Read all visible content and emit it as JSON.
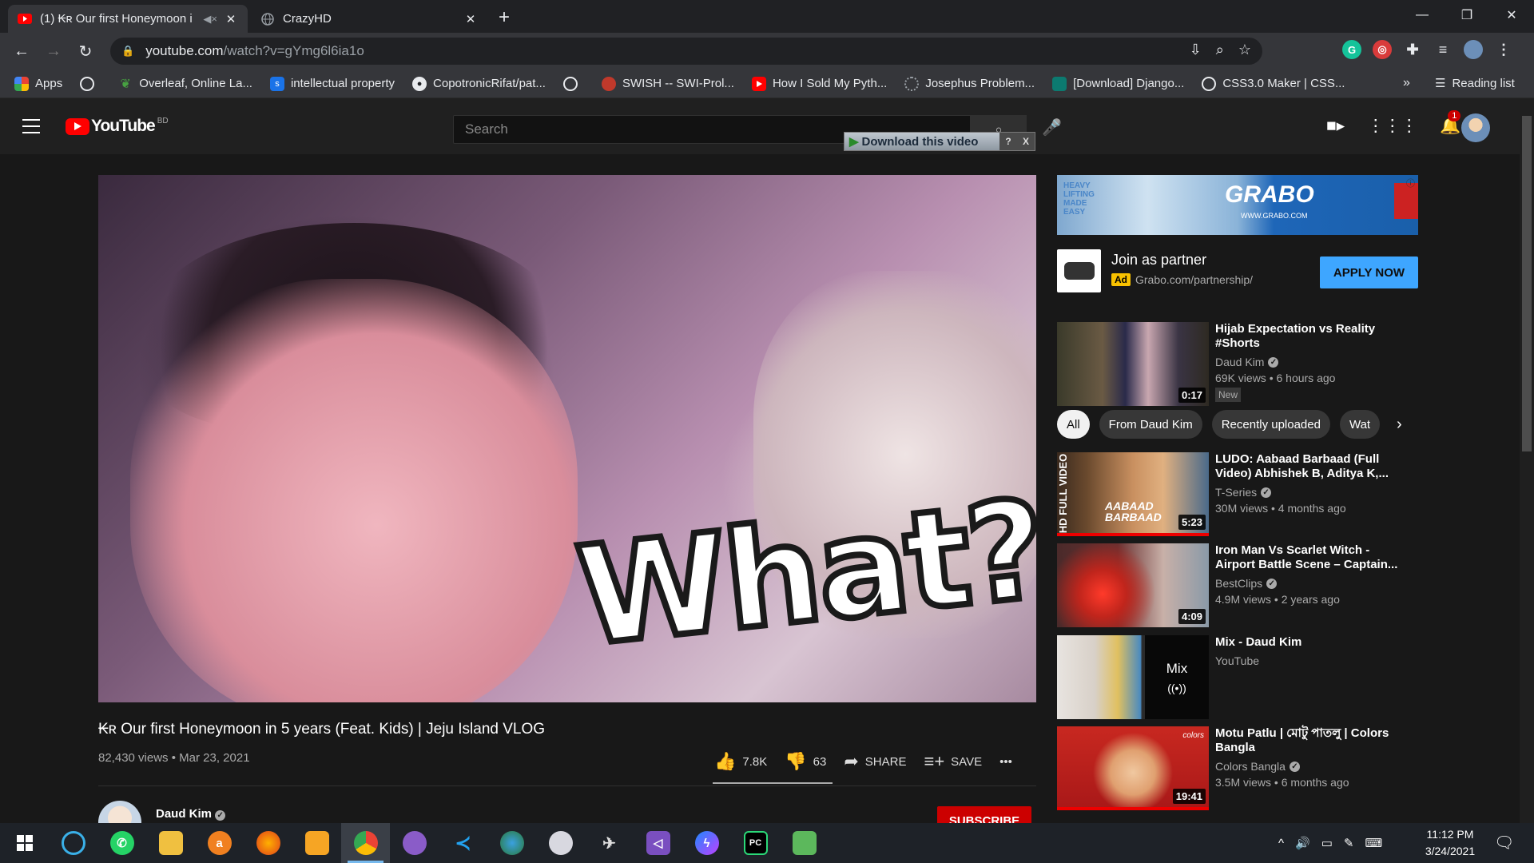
{
  "browser": {
    "tabs": [
      {
        "title": "(1) ₭ʀ Our first Honeymoon i",
        "audio": "◀×",
        "active": true
      },
      {
        "title": "CrazyHD",
        "active": false
      }
    ],
    "url_host": "youtube.com",
    "url_path": "/watch?v=gYmg6l6ia1o",
    "bookmarks": [
      {
        "label": "Apps",
        "icon": "apps-icon"
      },
      {
        "label": "",
        "icon": "globe-icon"
      },
      {
        "label": "Overleaf, Online La...",
        "icon": "overleaf-icon"
      },
      {
        "label": "intellectual property",
        "icon": "s-icon"
      },
      {
        "label": "CopotronicRifat/pat...",
        "icon": "github-icon"
      },
      {
        "label": "",
        "icon": "globe-icon"
      },
      {
        "label": "SWISH -- SWI-Prol...",
        "icon": "swish-icon"
      },
      {
        "label": "How I Sold My Pyth...",
        "icon": "youtube-icon"
      },
      {
        "label": "Josephus Problem...",
        "icon": "loading-icon"
      },
      {
        "label": "[Download] Django...",
        "icon": "django-icon"
      },
      {
        "label": "CSS3.0 Maker | CSS...",
        "icon": "globe-icon"
      }
    ],
    "bookmarks_more": "»",
    "reading_list": "Reading list"
  },
  "youtube": {
    "logo_text": "YouTube",
    "country": "BD",
    "search_placeholder": "Search",
    "download_bar": "Download this video",
    "download_help": "?",
    "download_close": "X",
    "notification_count": "1"
  },
  "video": {
    "overlay_text": "What?",
    "title": "₭ʀ Our first Honeymoon in 5 years (Feat. Kids) | Jeju Island VLOG",
    "views": "82,430 views",
    "date": "Mar 23, 2021",
    "likes": "7.8K",
    "dislikes": "63",
    "share_label": "SHARE",
    "save_label": "SAVE",
    "more_label": "•••",
    "channel": "Daud Kim",
    "subscribe_label": "SUBSCRIBE"
  },
  "ad": {
    "banner_brand": "GRABO",
    "banner_slogan": "HEAVY LIFTING MADE EASY",
    "banner_site": "WWW.GRABO.COM",
    "title": "Join as partner",
    "badge": "Ad",
    "url": "Grabo.com/partnership/",
    "cta": "APPLY NOW"
  },
  "chips": [
    "All",
    "From Daud Kim",
    "Recently uploaded",
    "Wat"
  ],
  "recommendations": [
    {
      "title": "Hijab Expectation vs Reality #Shorts",
      "channel": "Daud Kim",
      "verified": true,
      "meta": "69K views • 6 hours ago",
      "badge": "New",
      "duration": "0:17"
    },
    {
      "title": "LUDO: Aabaad Barbaad (Full Video) Abhishek B, Aditya K,...",
      "channel": "T-Series",
      "verified": true,
      "meta": "30M views • 4 months ago",
      "duration": "5:23",
      "thumb_text": "HD FULL VIDEO",
      "thumb_sub": "AABAAD BARBAAD"
    },
    {
      "title": "Iron Man Vs Scarlet Witch - Airport Battle Scene – Captain...",
      "channel": "BestClips",
      "verified": true,
      "meta": "4.9M views • 2 years ago",
      "duration": "4:09"
    },
    {
      "title": "Mix - Daud Kim",
      "channel": "YouTube",
      "verified": false,
      "meta": "",
      "mix_label": "Mix",
      "mix_icon": "((•))"
    },
    {
      "title": "Motu Patlu | মোটু পাতলু | Colors Bangla",
      "channel": "Colors Bangla",
      "verified": true,
      "meta": "3.5M views • 6 months ago",
      "duration": "19:41",
      "thumb_text": "colors"
    }
  ],
  "taskbar": {
    "apps": [
      "start",
      "refresh",
      "whatsapp",
      "explorer",
      "avast",
      "firefox",
      "office",
      "chrome",
      "github-desktop",
      "vscode",
      "globe-app",
      "brain-app",
      "satellite-app",
      "visual-studio",
      "messenger",
      "pycharm",
      "notepad"
    ],
    "time": "11:12 PM",
    "date": "3/24/2021",
    "tray": [
      "^",
      "🔊",
      "▭",
      "✎",
      "⌨"
    ]
  },
  "colors": {
    "yt_red": "#ff0000",
    "accent_blue": "#3ea6ff",
    "bg": "#181818",
    "header": "#202020"
  }
}
